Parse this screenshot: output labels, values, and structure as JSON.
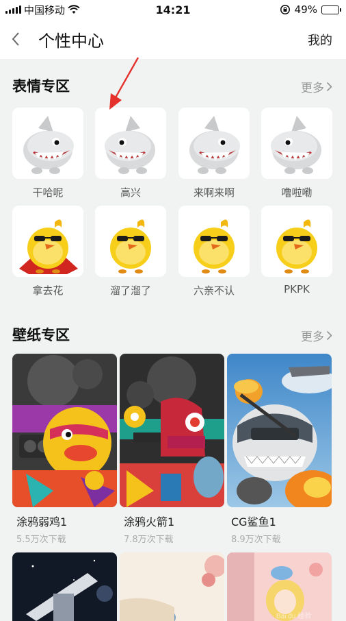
{
  "status_bar": {
    "carrier": "中国移动",
    "time": "14:21",
    "battery": "49%",
    "battery_level": 0.49
  },
  "nav": {
    "title": "个性中心",
    "right_link": "我的"
  },
  "sticker_section": {
    "title": "表情专区",
    "more": "更多",
    "items": [
      {
        "label": "干哈呢",
        "kind": "shark"
      },
      {
        "label": "高兴",
        "kind": "shark"
      },
      {
        "label": "来啊来啊",
        "kind": "shark"
      },
      {
        "label": "噜啦嘞",
        "kind": "shark"
      },
      {
        "label": "拿去花",
        "kind": "chick"
      },
      {
        "label": "溜了溜了",
        "kind": "chick"
      },
      {
        "label": "六亲不认",
        "kind": "chick"
      },
      {
        "label": "PKPK",
        "kind": "chick"
      }
    ]
  },
  "wallpaper_section": {
    "title": "壁纸专区",
    "more": "更多",
    "items": [
      {
        "name": "涂鸦弱鸡1",
        "downloads": "5.5万次下载"
      },
      {
        "name": "涂鸦火箭1",
        "downloads": "7.8万次下载"
      },
      {
        "name": "CG鲨鱼1",
        "downloads": "8.9万次下载"
      }
    ]
  },
  "colors": {
    "accent_red": "#e4312b",
    "background": "#f1f3f2",
    "chick_yellow": "#f7cf1b",
    "shark_grey": "#d9dadb"
  }
}
